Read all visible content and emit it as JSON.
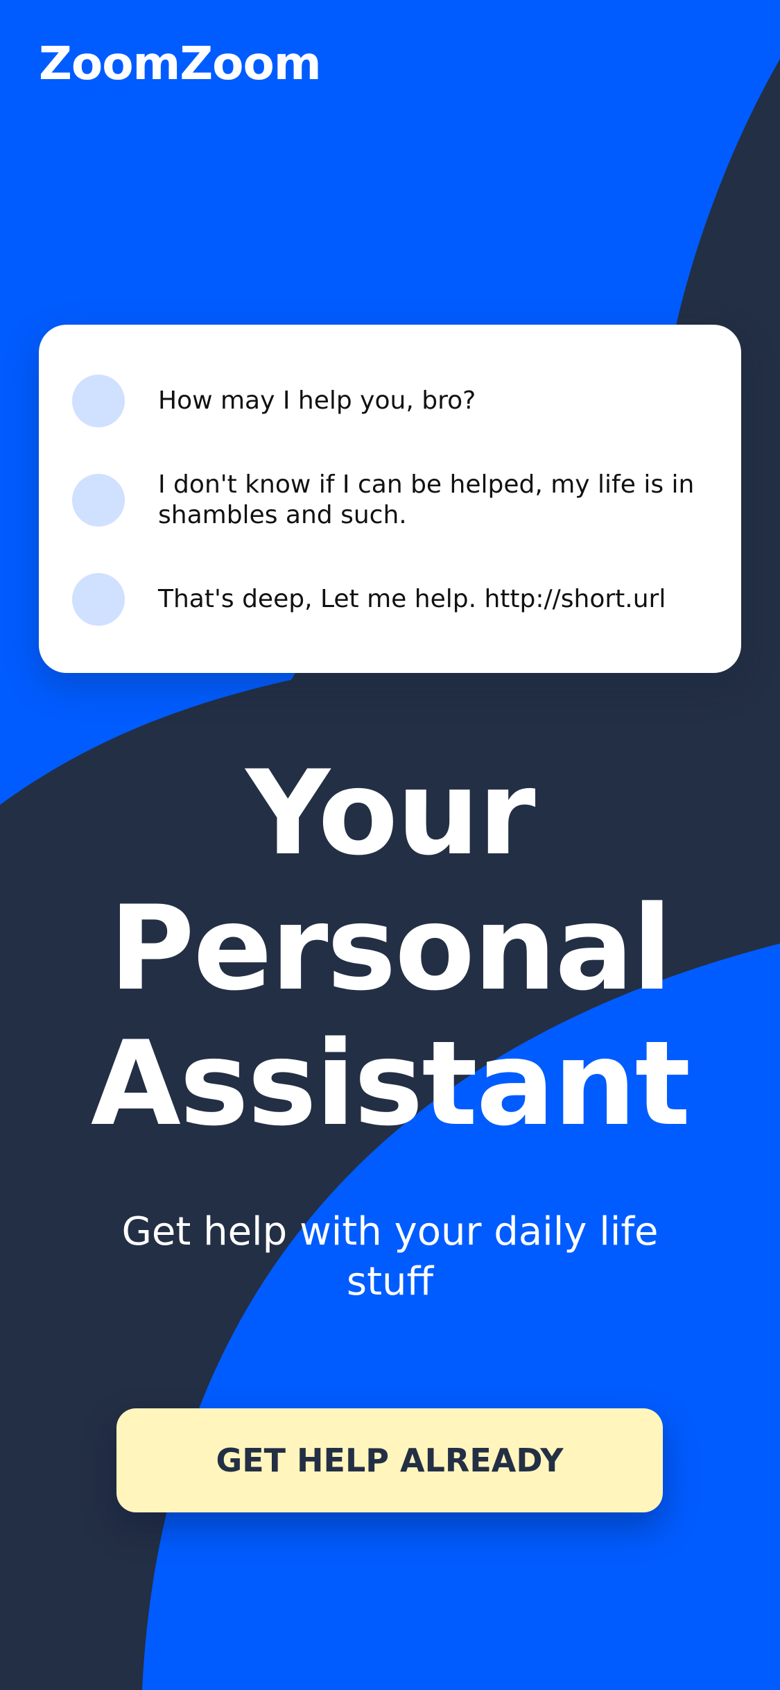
{
  "app": {
    "logo_text": "ZoomZoom"
  },
  "colors": {
    "primary_blue": "#005cff",
    "dark_navy": "#232f44",
    "card_background": "#ffffff",
    "avatar_placeholder": "#d0e0ff",
    "cta_background": "#fff5bd",
    "cta_text": "#232f44"
  },
  "chat": {
    "messages": [
      {
        "text": "How may I help you, bro?"
      },
      {
        "text": "I don't know if I can be helped, my life is in shambles and such."
      },
      {
        "text": "That's deep, Let me help. http://short.url"
      }
    ]
  },
  "hero": {
    "title_lines": [
      "Your",
      "Personal",
      "Assistant"
    ],
    "subtitle": "Get help with your daily life stuff"
  },
  "cta": {
    "label": "GET HELP ALREADY"
  }
}
